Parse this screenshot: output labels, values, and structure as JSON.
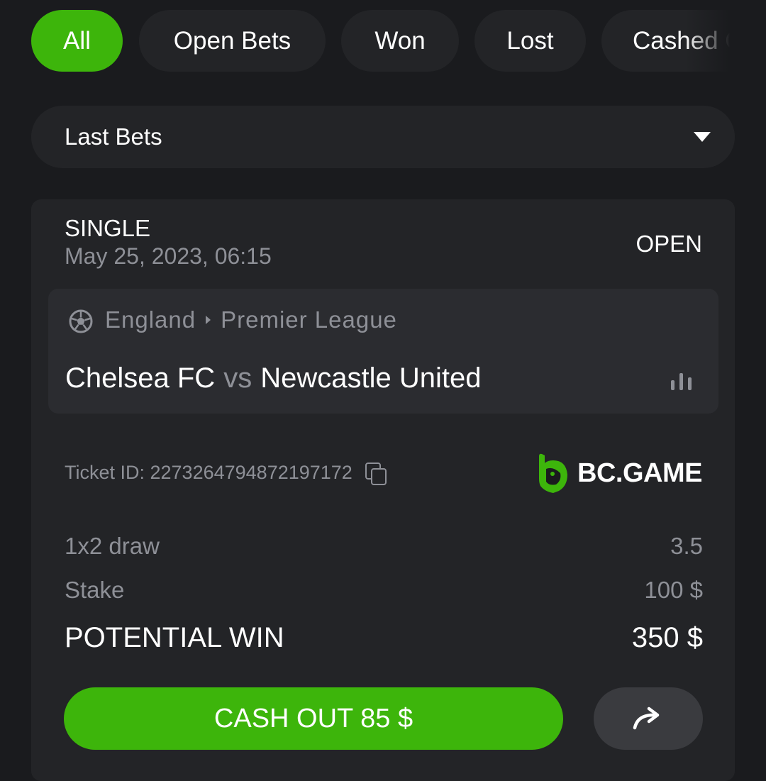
{
  "filter_tabs": [
    {
      "label": "All",
      "active": true
    },
    {
      "label": "Open Bets",
      "active": false
    },
    {
      "label": "Won",
      "active": false
    },
    {
      "label": "Lost",
      "active": false
    },
    {
      "label": "Cashed O",
      "active": false
    }
  ],
  "dropdown": {
    "selected": "Last Bets",
    "icon": "caret-down-icon"
  },
  "bet": {
    "type": "SINGLE",
    "date": "May 25, 2023, 06:15",
    "status": "OPEN",
    "sport_icon": "soccer-ball-icon",
    "country": "England",
    "league": "Premier League",
    "home_team": "Chelsea FC",
    "vs": "vs",
    "away_team": "Newcastle United",
    "stats_icon": "bar-chart-icon",
    "ticket_label": "Ticket ID: 2273264794872197172",
    "brand": "BC.GAME",
    "selection_label": "1x2 draw",
    "odds": "3.5",
    "stake_label": "Stake",
    "stake_value": "100 $",
    "potential_win_label": "POTENTIAL WIN",
    "potential_win_value": "350 $",
    "cashout_label": "CASH OUT 85 $",
    "share_icon": "share-arrow-icon"
  },
  "colors": {
    "accent": "#3db50b",
    "background": "#1a1b1e",
    "card": "#232427",
    "muted_text": "#8e9097"
  }
}
